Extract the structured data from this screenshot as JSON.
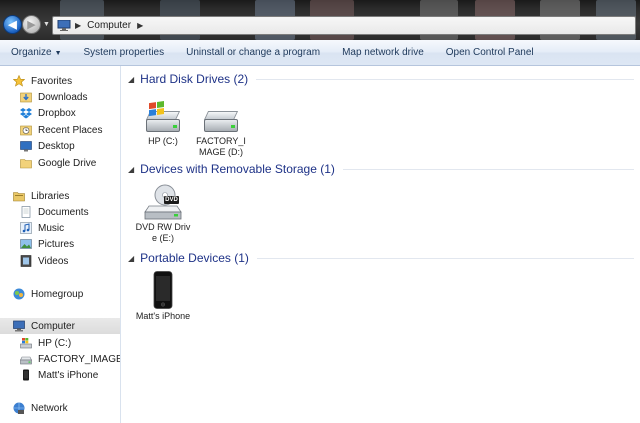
{
  "address": {
    "location": "Computer"
  },
  "toolbar": {
    "items": [
      {
        "label": "Organize",
        "has_dropdown": true
      },
      {
        "label": "System properties"
      },
      {
        "label": "Uninstall or change a program"
      },
      {
        "label": "Map network drive"
      },
      {
        "label": "Open Control Panel"
      }
    ]
  },
  "nav": {
    "favorites": {
      "label": "Favorites",
      "icon": "star-icon"
    },
    "downloads": {
      "label": "Downloads",
      "icon": "downloads-folder-icon"
    },
    "dropbox": {
      "label": "Dropbox",
      "icon": "dropbox-icon"
    },
    "recent_places": {
      "label": "Recent Places",
      "icon": "recent-places-icon"
    },
    "desktop": {
      "label": "Desktop",
      "icon": "desktop-icon"
    },
    "google_drive": {
      "label": "Google Drive",
      "icon": "folder-icon"
    },
    "libraries": {
      "label": "Libraries",
      "icon": "libraries-icon"
    },
    "documents": {
      "label": "Documents",
      "icon": "documents-icon"
    },
    "music": {
      "label": "Music",
      "icon": "music-icon"
    },
    "pictures": {
      "label": "Pictures",
      "icon": "pictures-icon"
    },
    "videos": {
      "label": "Videos",
      "icon": "videos-icon"
    },
    "homegroup": {
      "label": "Homegroup",
      "icon": "homegroup-icon"
    },
    "computer": {
      "label": "Computer",
      "icon": "computer-icon",
      "selected": true
    },
    "hp_c": {
      "label": "HP (C:)",
      "icon": "windows-drive-icon"
    },
    "factory_image": {
      "label": "FACTORY_IMAGE (D",
      "icon": "drive-icon"
    },
    "matts_iphone": {
      "label": "Matt's iPhone",
      "icon": "phone-icon"
    },
    "network": {
      "label": "Network",
      "icon": "network-icon"
    }
  },
  "groups": {
    "hard_disk": {
      "title": "Hard Disk Drives (2)",
      "items": [
        {
          "label": "HP (C:)",
          "icon": "windows-drive-icon"
        },
        {
          "label": "FACTORY_IMAGE (D:)",
          "icon": "drive-icon"
        }
      ]
    },
    "removable": {
      "title": "Devices with Removable Storage (1)",
      "items": [
        {
          "label": "DVD RW Drive (E:)",
          "icon": "dvd-drive-icon",
          "badge": "DVD"
        }
      ]
    },
    "portable": {
      "title": "Portable Devices (1)",
      "items": [
        {
          "label": "Matt's iPhone",
          "icon": "iphone-icon"
        }
      ]
    }
  },
  "colors": {
    "group_title": "#1e3287",
    "toolbar_text": "#1e395b",
    "selection": "#dcdcdc"
  }
}
